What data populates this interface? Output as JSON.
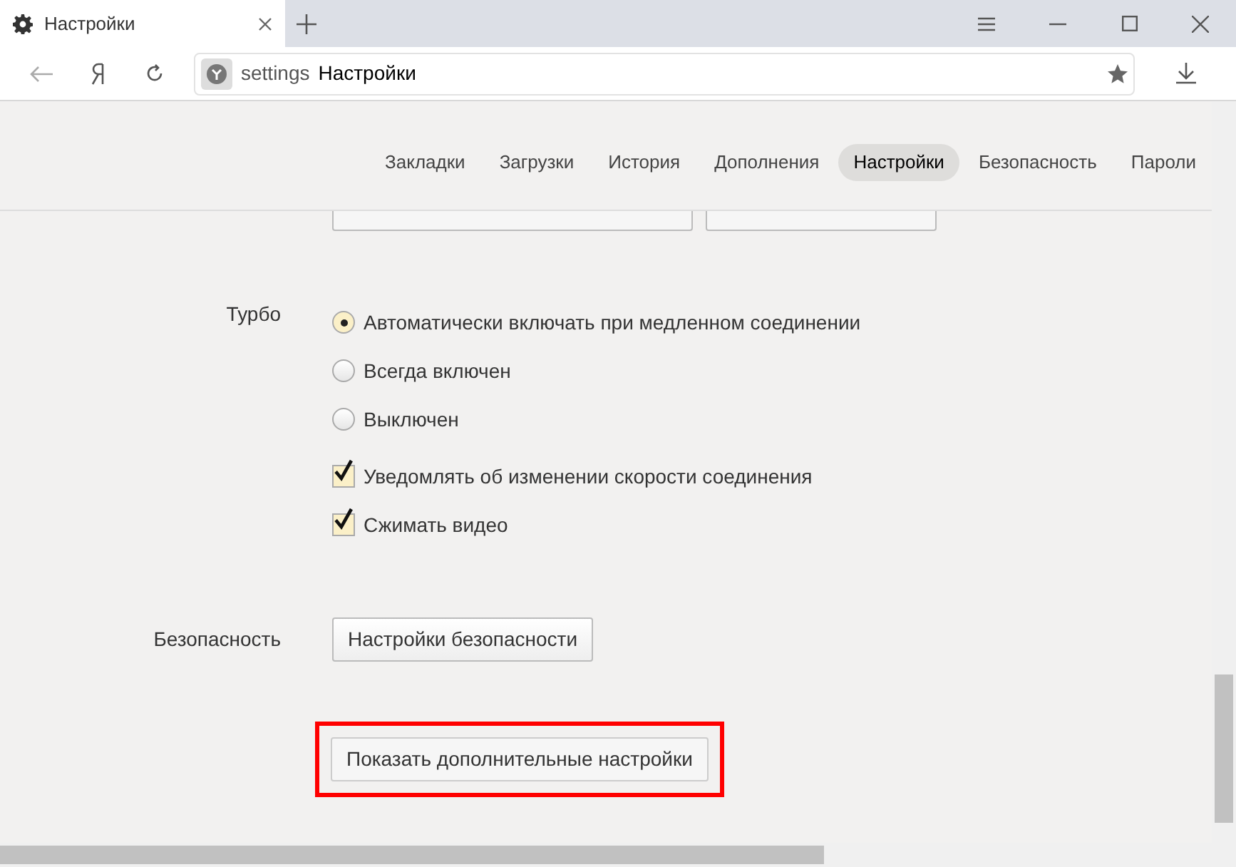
{
  "tab": {
    "title": "Настройки"
  },
  "address_bar": {
    "host": "settings",
    "page_title": "Настройки"
  },
  "nav": [
    {
      "label": "Закладки",
      "selected": false
    },
    {
      "label": "Загрузки",
      "selected": false
    },
    {
      "label": "История",
      "selected": false
    },
    {
      "label": "Дополнения",
      "selected": false
    },
    {
      "label": "Настройки",
      "selected": true
    },
    {
      "label": "Безопасность",
      "selected": false
    },
    {
      "label": "Пароли",
      "selected": false
    }
  ],
  "turbo": {
    "label": "Турбо",
    "options": [
      {
        "kind": "radio",
        "label": "Автоматически включать при медленном соединении",
        "checked": true
      },
      {
        "kind": "radio",
        "label": "Всегда включен",
        "checked": false
      },
      {
        "kind": "radio",
        "label": "Выключен",
        "checked": false
      },
      {
        "kind": "checkbox",
        "label": "Уведомлять об изменении скорости соединения",
        "checked": true
      },
      {
        "kind": "checkbox",
        "label": "Сжимать видео",
        "checked": true
      }
    ]
  },
  "security": {
    "label": "Безопасность",
    "button": "Настройки безопасности"
  },
  "show_more_button": {
    "label": "Показать дополнительные настройки",
    "highlighted": true
  }
}
